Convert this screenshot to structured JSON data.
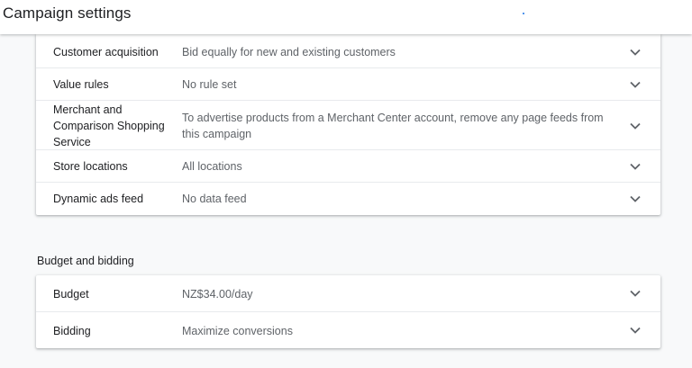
{
  "header": {
    "title": "Campaign settings"
  },
  "settings": {
    "rows": [
      {
        "label": "Customer acquisition",
        "value": "Bid equally for new and existing customers"
      },
      {
        "label": "Value rules",
        "value": "No rule set"
      },
      {
        "label": "Merchant and Comparison Shopping Service",
        "value": "To advertise products from a Merchant Center account, remove any page feeds from this campaign"
      },
      {
        "label": "Store locations",
        "value": "All locations"
      },
      {
        "label": "Dynamic ads feed",
        "value": "No data feed"
      }
    ]
  },
  "budget_section": {
    "title": "Budget and bidding",
    "rows": [
      {
        "label": "Budget",
        "value": "NZ$34.00/day"
      },
      {
        "label": "Bidding",
        "value": "Maximize conversions"
      }
    ]
  },
  "icons": {
    "expand": "chevron-down-icon"
  },
  "colors": {
    "accent": "#1a73e8",
    "chevron": "#5f6368"
  }
}
